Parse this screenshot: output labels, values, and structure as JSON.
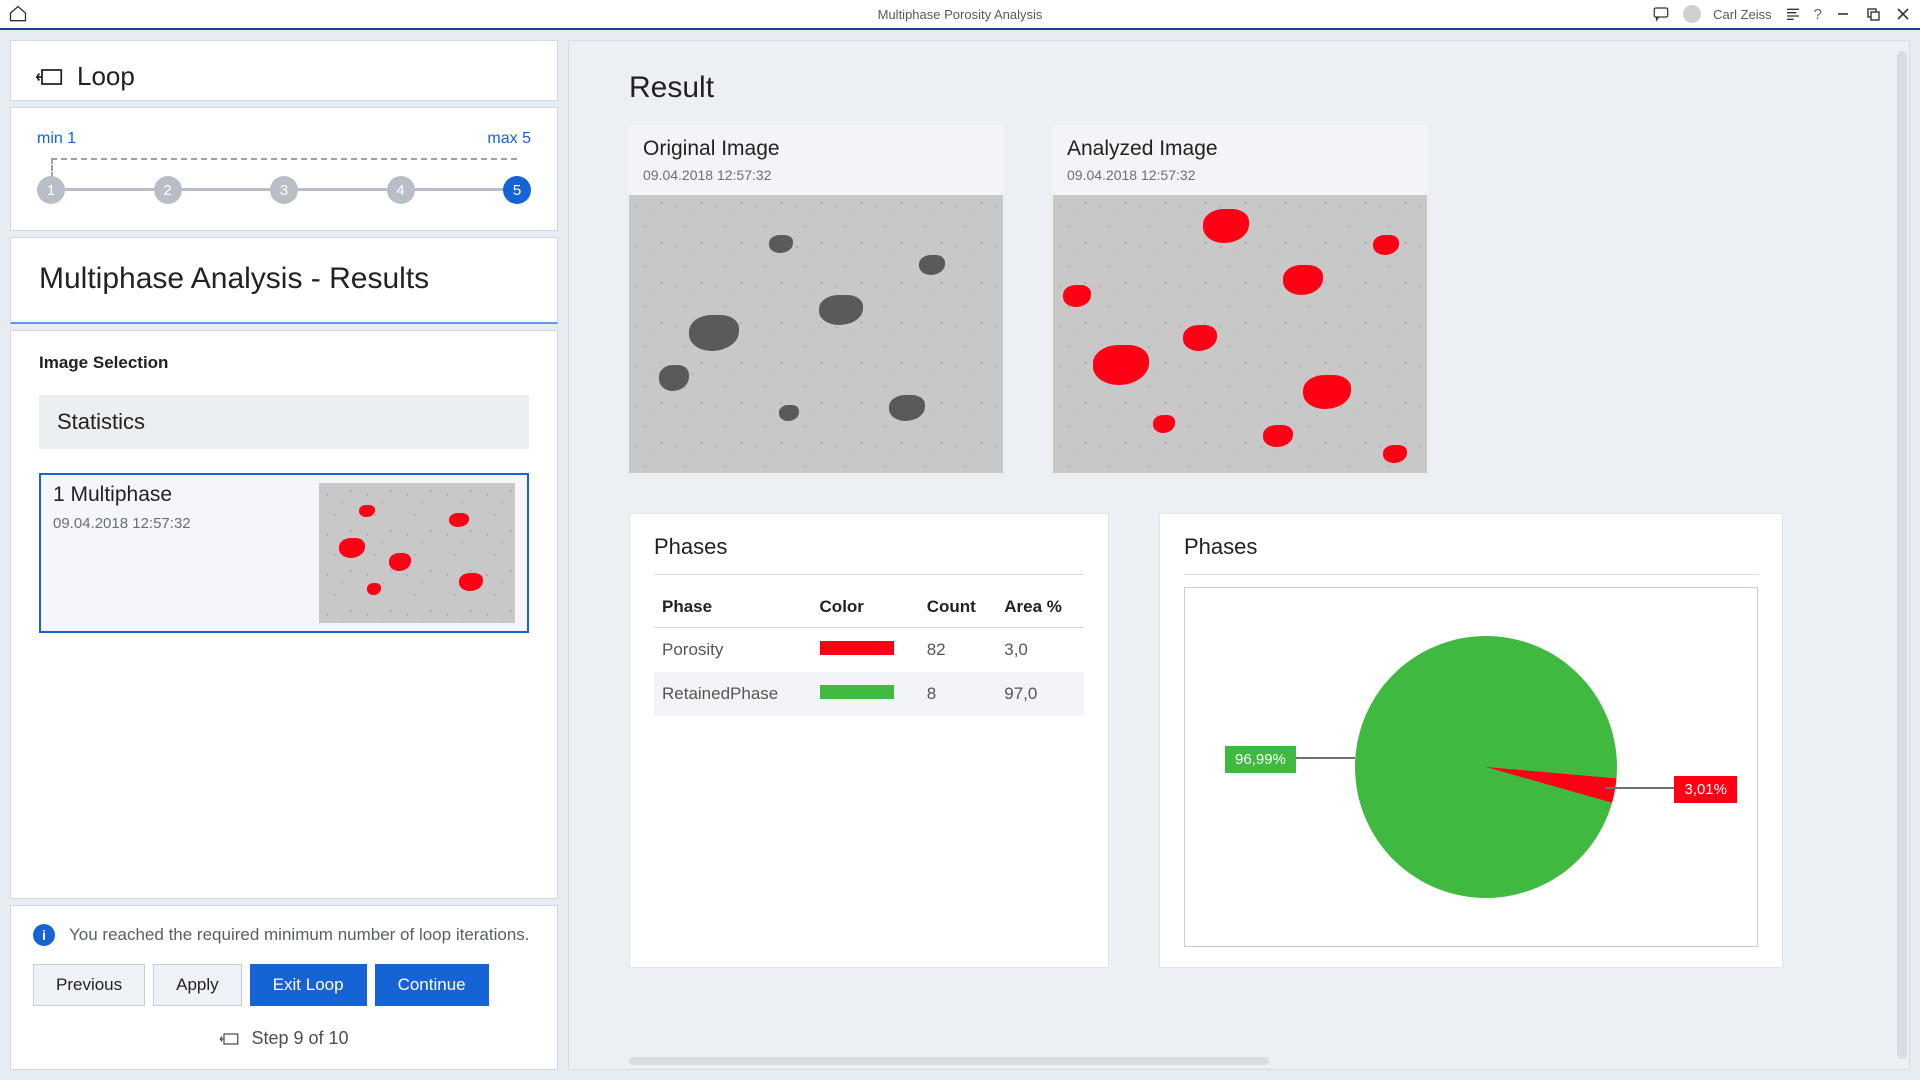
{
  "titlebar": {
    "title": "Multiphase Porosity Analysis",
    "user": "Carl Zeiss"
  },
  "sidebar": {
    "loop_label": "Loop",
    "loop_min": "min 1",
    "loop_max": "max 5",
    "steps": [
      "1",
      "2",
      "3",
      "4",
      "5"
    ],
    "active_step_index": 4,
    "results_title": "Multiphase Analysis - Results",
    "image_selection_label": "Image Selection",
    "statistics_label": "Statistics",
    "image_item": {
      "name": "1 Multiphase",
      "timestamp": "09.04.2018 12:57:32"
    },
    "info_text": "You reached the required minimum number of loop iterations.",
    "buttons": {
      "previous": "Previous",
      "apply": "Apply",
      "exit_loop": "Exit Loop",
      "continue": "Continue"
    },
    "step_indicator": "Step 9 of 10"
  },
  "main": {
    "result_heading": "Result",
    "original": {
      "title": "Original Image",
      "timestamp": "09.04.2018 12:57:32"
    },
    "analyzed": {
      "title": "Analyzed Image",
      "timestamp": "09.04.2018 12:57:32"
    },
    "phases_table": {
      "heading": "Phases",
      "columns": [
        "Phase",
        "Color",
        "Count",
        "Area %"
      ],
      "rows": [
        {
          "phase": "Porosity",
          "color": "#ff0015",
          "count": "82",
          "area": "3,0"
        },
        {
          "phase": "RetainedPhase",
          "color": "#3fb93f",
          "count": "8",
          "area": "97,0"
        }
      ]
    },
    "phases_chart": {
      "heading": "Phases",
      "green_label": "96,99%",
      "red_label": "3,01%"
    }
  },
  "chart_data": {
    "type": "pie",
    "title": "Phases",
    "series": [
      {
        "name": "RetainedPhase",
        "value": 96.99,
        "color": "#3fb93f"
      },
      {
        "name": "Porosity",
        "value": 3.01,
        "color": "#ff0015"
      }
    ]
  }
}
